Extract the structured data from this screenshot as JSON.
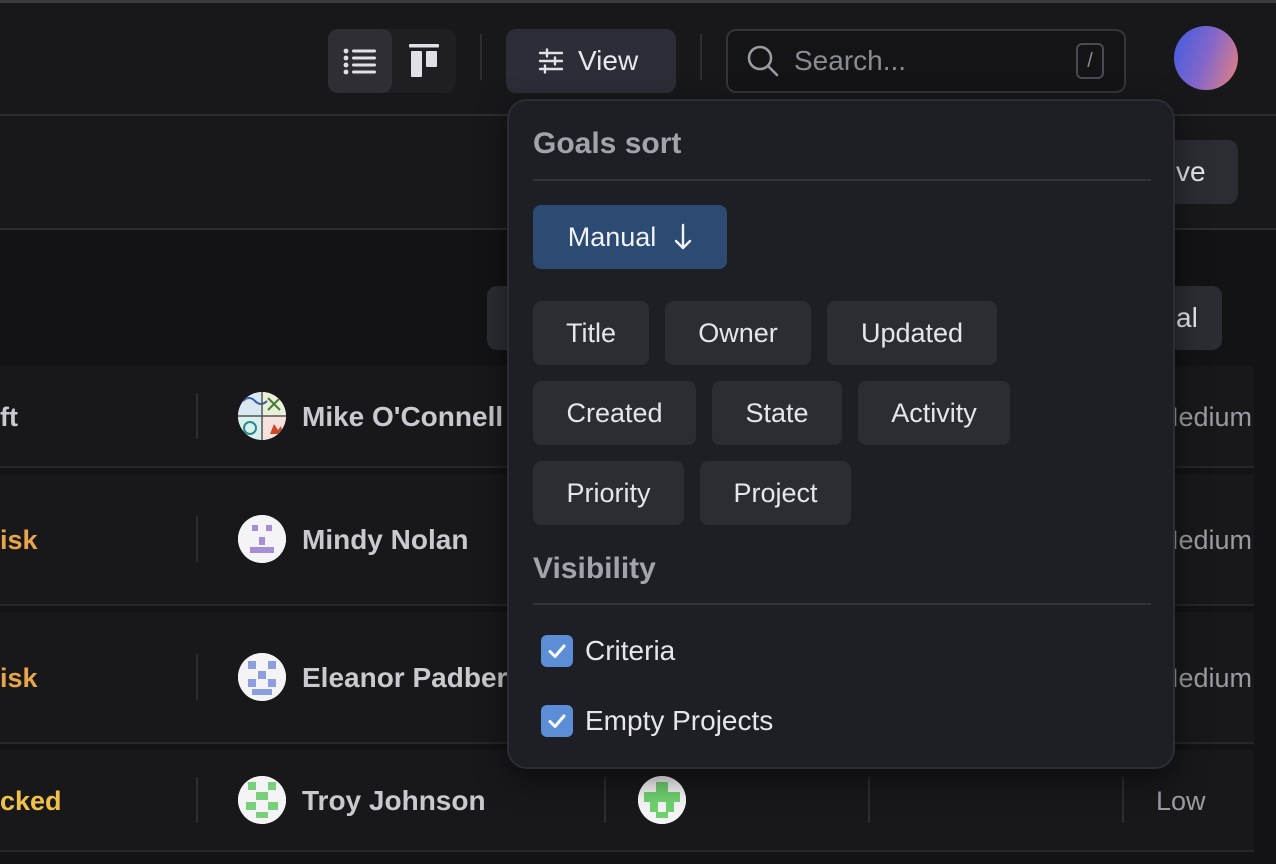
{
  "header": {
    "view_label": "View",
    "search_placeholder": "Search...",
    "search_shortcut": "/",
    "layout_icons": [
      "list-icon",
      "board-icon"
    ]
  },
  "actions": {
    "save_label_visible": "ve",
    "goal_label_visible": "al"
  },
  "rows": [
    {
      "state": "ft",
      "state_color": "#c9c9cf",
      "owner": "Mike O'Connell",
      "priority": "Medium"
    },
    {
      "state": "isk",
      "state_color": "#e8a64a",
      "owner": "Mindy Nolan",
      "priority": "Medium"
    },
    {
      "state": "isk",
      "state_color": "#e8a64a",
      "owner": "Eleanor Padberg",
      "priority": "Medium"
    },
    {
      "state": "cked",
      "state_color": "#f0c24a",
      "owner": "Troy Johnson",
      "priority": "Low"
    }
  ],
  "view_menu": {
    "sort_heading": "Goals sort",
    "active_sort": "Manual",
    "active_sort_direction_icon": "arrow-down-icon",
    "sort_options": [
      "Title",
      "Owner",
      "Updated",
      "Created",
      "State",
      "Activity",
      "Priority",
      "Project"
    ],
    "visibility_heading": "Visibility",
    "visibility_options": [
      {
        "label": "Criteria",
        "checked": true
      },
      {
        "label": "Empty Projects",
        "checked": true
      }
    ]
  }
}
